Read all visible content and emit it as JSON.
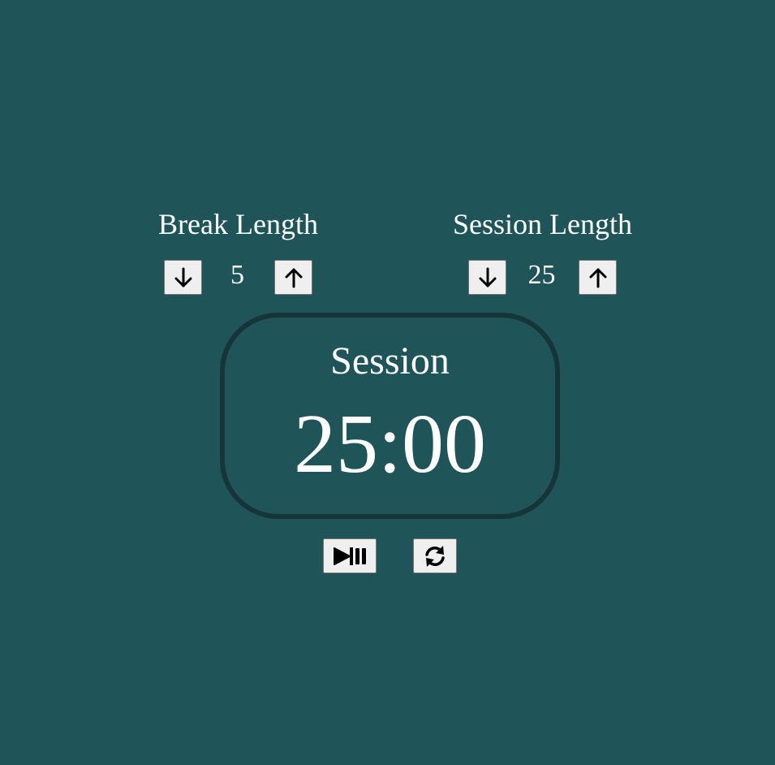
{
  "break": {
    "label": "Break Length",
    "value": "5",
    "decrement_icon": "arrow-down-icon",
    "increment_icon": "arrow-up-icon"
  },
  "session": {
    "label": "Session Length",
    "value": "25",
    "decrement_icon": "arrow-down-icon",
    "increment_icon": "arrow-up-icon"
  },
  "timer": {
    "label": "Session",
    "time_left": "25:00"
  },
  "controls": {
    "start_stop_icon": "play-pause-icon",
    "reset_icon": "refresh-icon"
  },
  "colors": {
    "background": "#1f5459",
    "timer_border": "#153539",
    "text": "#ffffff",
    "button_bg": "#efefef"
  }
}
